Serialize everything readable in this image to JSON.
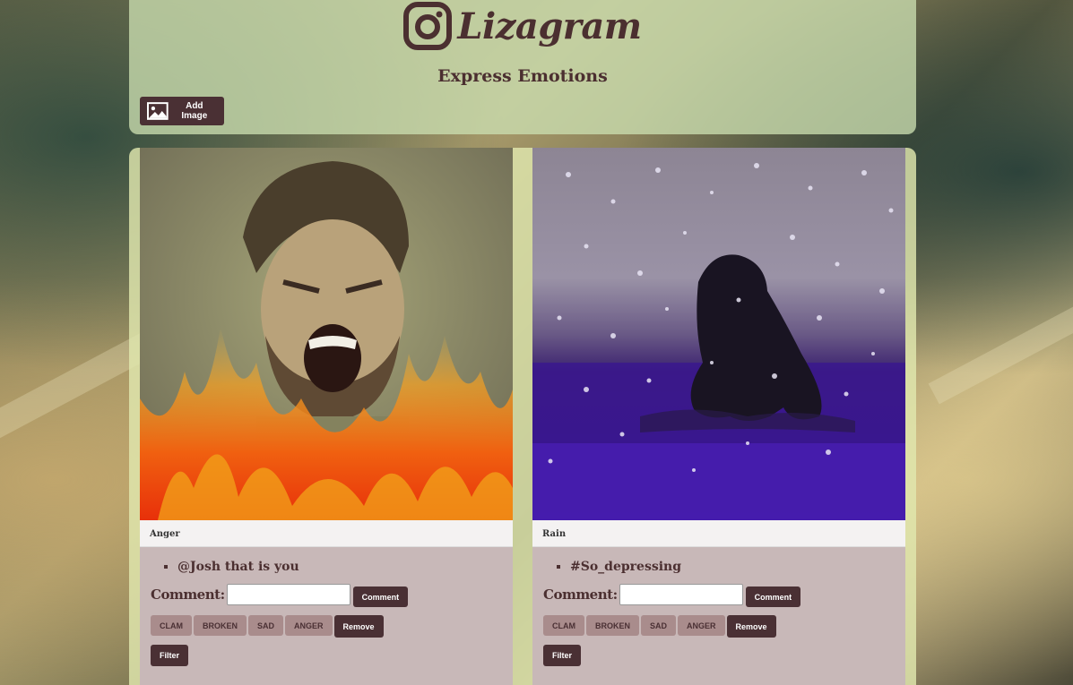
{
  "app": {
    "title": "Lizagram",
    "subtitle": "Express Emotions",
    "add_image_label": "Add Image"
  },
  "colors": {
    "primary_button": "#4a3034",
    "tag_button": "#a98c8c",
    "title_text": "#4b2f30",
    "header_bg": "#cbdeaf",
    "card_bg": "#c8b8b8"
  },
  "posts": [
    {
      "title": "Anger",
      "image_name": "anger-photo",
      "comments": [
        "@Josh that is you"
      ],
      "comment_label": "Comment:",
      "comment_input_value": "",
      "comment_button": "Comment",
      "tags": [
        "CLAM",
        "BROKEN",
        "SAD",
        "ANGER"
      ],
      "remove_label": "Remove",
      "filter_label": "Filter"
    },
    {
      "title": "Rain",
      "image_name": "rain-photo",
      "comments": [
        "#So_depressing"
      ],
      "comment_label": "Comment:",
      "comment_input_value": "",
      "comment_button": "Comment",
      "tags": [
        "CLAM",
        "BROKEN",
        "SAD",
        "ANGER"
      ],
      "remove_label": "Remove",
      "filter_label": "Filter"
    }
  ]
}
